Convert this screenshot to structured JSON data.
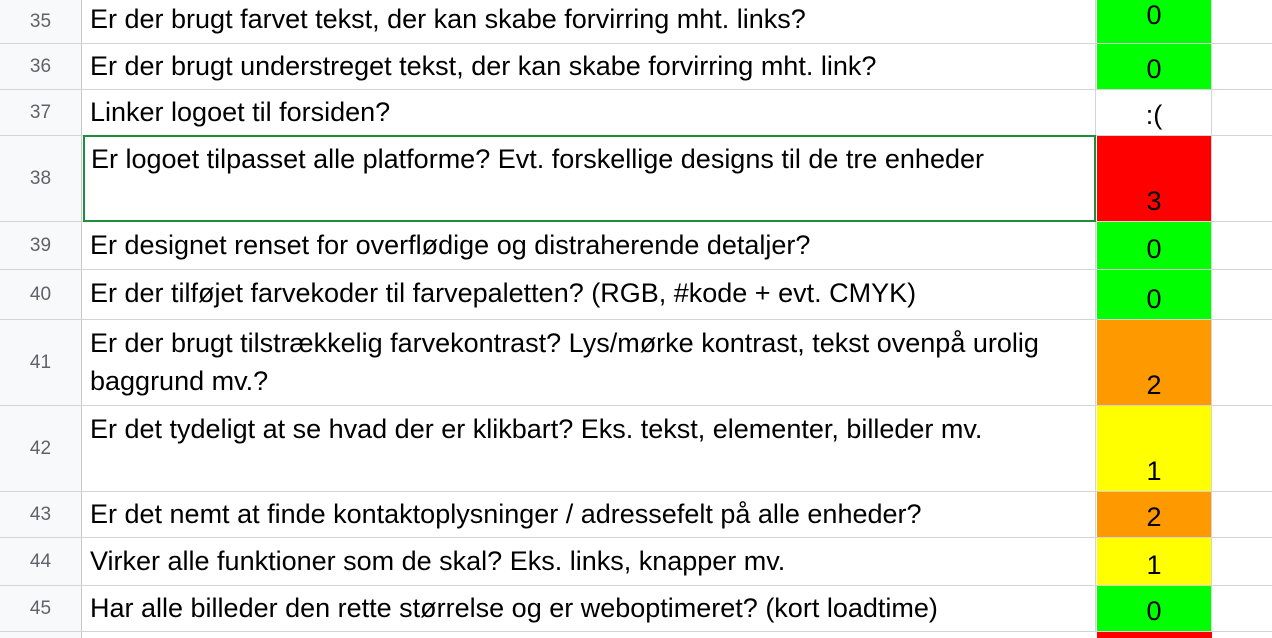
{
  "sheet": {
    "rows": [
      {
        "number": "35",
        "question": "Er der brugt farvet tekst, der kan skabe forvirring mht. links?",
        "score": "0",
        "level": "0"
      },
      {
        "number": "36",
        "question": "Er der brugt understreget tekst, der kan skabe forvirring mht. link?",
        "score": "0",
        "level": "0"
      },
      {
        "number": "37",
        "question": "Linker logoet til forsiden?",
        "score": ":(",
        "level": "none"
      },
      {
        "number": "38",
        "question": "Er logoet tilpasset alle platforme? Evt. forskellige designs til de tre enheder",
        "score": "3",
        "level": "3"
      },
      {
        "number": "39",
        "question": "Er designet renset for overflødige og distraherende detaljer?",
        "score": "0",
        "level": "0"
      },
      {
        "number": "40",
        "question": "Er der tilføjet farvekoder til farvepaletten? (RGB, #kode + evt. CMYK)",
        "score": "0",
        "level": "0"
      },
      {
        "number": "41",
        "question": "Er der brugt tilstrækkelig farvekontrast? Lys/mørke kontrast, tekst ovenpå urolig baggrund mv.?",
        "score": "2",
        "level": "2"
      },
      {
        "number": "42",
        "question": "Er det tydeligt at se hvad der er klikbart? Eks. tekst, elementer, billeder mv.",
        "score": "1",
        "level": "1"
      },
      {
        "number": "43",
        "question": "Er det nemt at finde kontaktoplysninger / adressefelt på alle enheder?",
        "score": "2",
        "level": "2"
      },
      {
        "number": "44",
        "question": "Virker alle funktioner som de skal? Eks. links, knapper mv.",
        "score": "1",
        "level": "1"
      },
      {
        "number": "45",
        "question": "Har alle billeder den rette størrelse og er weboptimeret? (kort loadtime)",
        "score": "0",
        "level": "0"
      }
    ],
    "selected_row": "38",
    "colors": {
      "score_0": "#00ff00",
      "score_1": "#ffff00",
      "score_2": "#ff9900",
      "score_3": "#ff0000",
      "selection": "#1e8e3e"
    }
  }
}
